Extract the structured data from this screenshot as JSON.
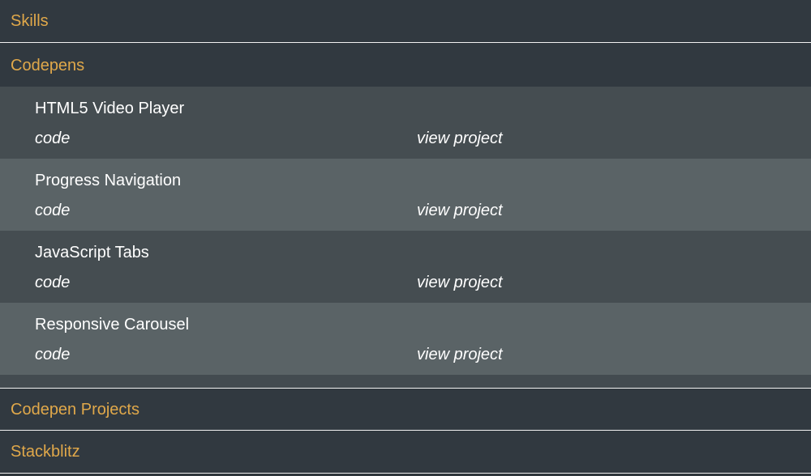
{
  "sections": [
    {
      "label": "Skills"
    },
    {
      "label": "Codepens"
    },
    {
      "label": "Codepen Projects"
    },
    {
      "label": "Stackblitz"
    }
  ],
  "codepens": {
    "items": [
      {
        "title": "HTML5 Video Player",
        "code_label": "code",
        "view_label": "view project"
      },
      {
        "title": "Progress Navigation",
        "code_label": "code",
        "view_label": "view project"
      },
      {
        "title": "JavaScript Tabs",
        "code_label": "code",
        "view_label": "view project"
      },
      {
        "title": "Responsive Carousel",
        "code_label": "code",
        "view_label": "view project"
      }
    ]
  },
  "colors": {
    "accent": "#e0a84a",
    "background": "#313940",
    "row_dark": "#454d51",
    "row_light": "#5a6366"
  }
}
